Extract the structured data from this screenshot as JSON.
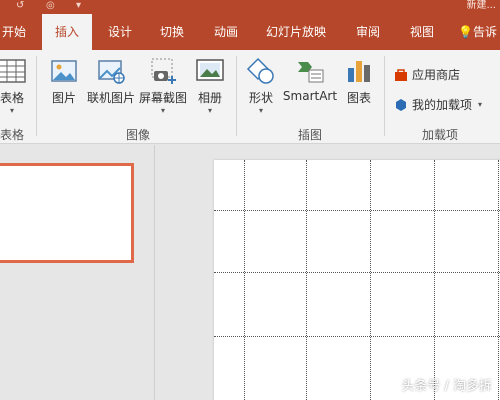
{
  "app": {
    "title": "新建..."
  },
  "tabs": [
    {
      "label": "开始",
      "active": false
    },
    {
      "label": "插入",
      "active": true
    },
    {
      "label": "设计",
      "active": false
    },
    {
      "label": "切换",
      "active": false
    },
    {
      "label": "动画",
      "active": false
    },
    {
      "label": "幻灯片放映",
      "active": false
    },
    {
      "label": "审阅",
      "active": false
    },
    {
      "label": "视图",
      "active": false
    },
    {
      "label": "告诉",
      "active": false
    }
  ],
  "ribbon": {
    "groups": {
      "table": {
        "label": "表格",
        "button": "表格"
      },
      "images": {
        "label": "图像",
        "buttons": [
          "图片",
          "联机图片",
          "屏幕截图",
          "相册"
        ]
      },
      "illustrations": {
        "label": "插图",
        "buttons": [
          "形状",
          "SmartArt",
          "图表"
        ]
      },
      "addins": {
        "label": "加载项",
        "buttons": [
          "应用商店",
          "我的加载项"
        ]
      }
    }
  },
  "watermark": "头条号 / 淘多拆",
  "colors": {
    "accent": "#b7472a",
    "thumb_border": "#e0694a"
  }
}
